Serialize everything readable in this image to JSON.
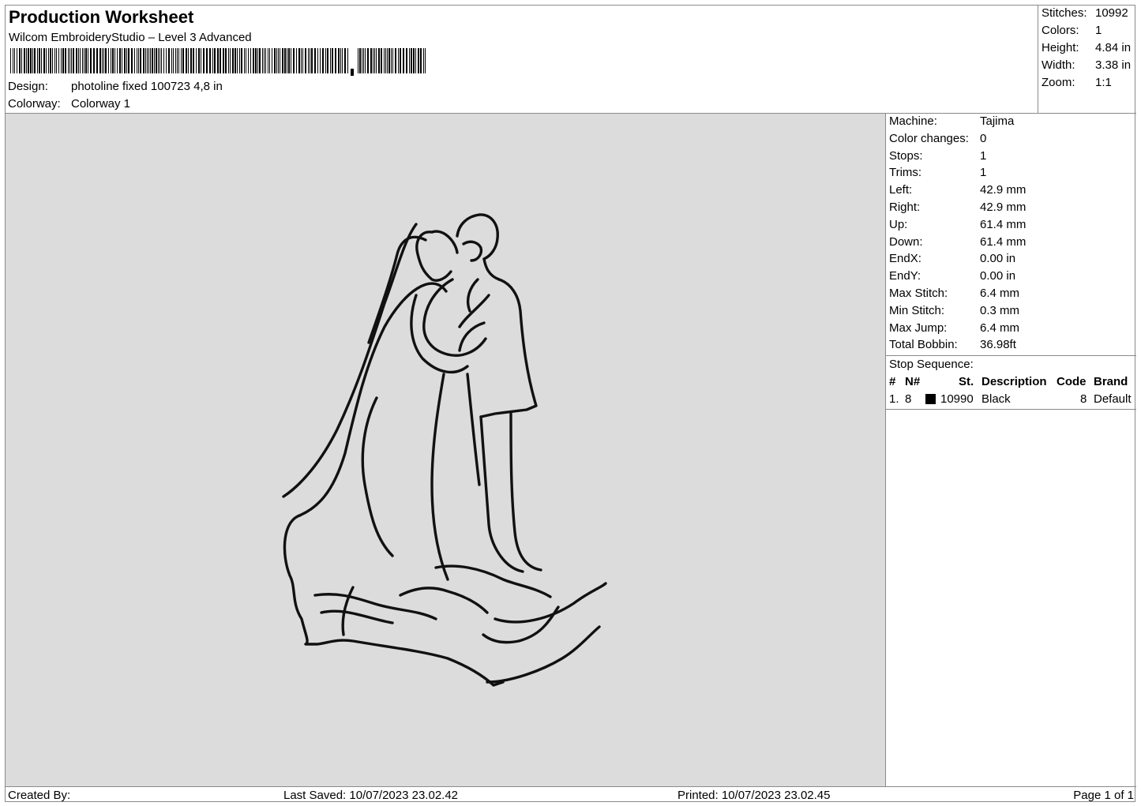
{
  "header": {
    "title": "Production Worksheet",
    "subtitle": "Wilcom EmbroideryStudio – Level 3 Advanced",
    "design_label": "Design:",
    "design_value": "photoline fixed 100723 4,8 in",
    "colorway_label": "Colorway:",
    "colorway_value": "Colorway 1"
  },
  "stats": [
    {
      "label": "Stitches:",
      "value": "10992"
    },
    {
      "label": "Colors:",
      "value": "1"
    },
    {
      "label": "Height:",
      "value": "4.84 in"
    },
    {
      "label": "Width:",
      "value": "3.38 in"
    },
    {
      "label": "Zoom:",
      "value": "1:1"
    }
  ],
  "machine_info": [
    {
      "label": "Machine:",
      "value": "Tajima"
    },
    {
      "label": "Color changes:",
      "value": "0"
    },
    {
      "label": "Stops:",
      "value": "1"
    },
    {
      "label": "Trims:",
      "value": "1"
    },
    {
      "label": "Left:",
      "value": "42.9 mm"
    },
    {
      "label": "Right:",
      "value": "42.9 mm"
    },
    {
      "label": "Up:",
      "value": "61.4 mm"
    },
    {
      "label": "Down:",
      "value": "61.4 mm"
    },
    {
      "label": "EndX:",
      "value": "0.00 in"
    },
    {
      "label": "EndY:",
      "value": "0.00 in"
    },
    {
      "label": "Max Stitch:",
      "value": "6.4 mm"
    },
    {
      "label": "Min Stitch:",
      "value": "0.3 mm"
    },
    {
      "label": "Max Jump:",
      "value": "6.4 mm"
    },
    {
      "label": "Total Bobbin:",
      "value": "36.98ft"
    }
  ],
  "stop_sequence": {
    "title": "Stop Sequence:",
    "columns": {
      "num": "#",
      "n": "N#",
      "st": "St.",
      "description": "Description",
      "code": "Code",
      "brand": "Brand"
    },
    "rows": [
      {
        "num": "1.",
        "n": "8",
        "swatch_color": "#000000",
        "st": "10990",
        "description": "Black",
        "code": "8",
        "brand": "Default"
      }
    ]
  },
  "footer": {
    "created_by": "Created By:",
    "last_saved": "Last Saved: 10/07/2023 23.02.42",
    "printed": "Printed: 10/07/2023 23.02.45",
    "page": "Page 1 of 1"
  },
  "colors": {
    "canvas_bg": "#dcdcdc",
    "thread": "#000000",
    "border": "#8a8a8a"
  }
}
